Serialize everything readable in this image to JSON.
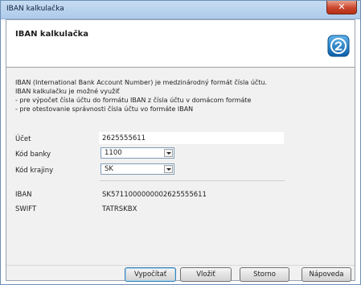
{
  "window": {
    "title": "IBAN kalkulačka"
  },
  "header": {
    "title": "IBAN kalkulačka",
    "logo_icon": "calculator-logo-icon"
  },
  "description": {
    "lines": [
      "IBAN (International Bank Account Number) je medzinárodný formát čísla účtu.",
      "IBAN kalkulačku je možné využiť",
      " - pre výpočet čísla účtu do formátu IBAN z čísla účtu v domácom formáte",
      " - pre otestovanie správnosti čísla účtu vo formáte IBAN"
    ]
  },
  "form": {
    "account_label": "Účet",
    "account_value": "2625555611",
    "bank_code_label": "Kód banky",
    "bank_code_value": "1100",
    "country_label": "Kód krajiny",
    "country_value": "SK",
    "iban_label": "IBAN",
    "iban_value": "SK5711000000002625555611",
    "swift_label": "SWIFT",
    "swift_value": "TATRSKBX"
  },
  "buttons": {
    "calculate": "Vypočítať",
    "insert": "Vložiť",
    "cancel": "Storno",
    "help": "Nápoveda"
  },
  "colors": {
    "accent": "#1a6fb3",
    "close": "#c9452c"
  }
}
